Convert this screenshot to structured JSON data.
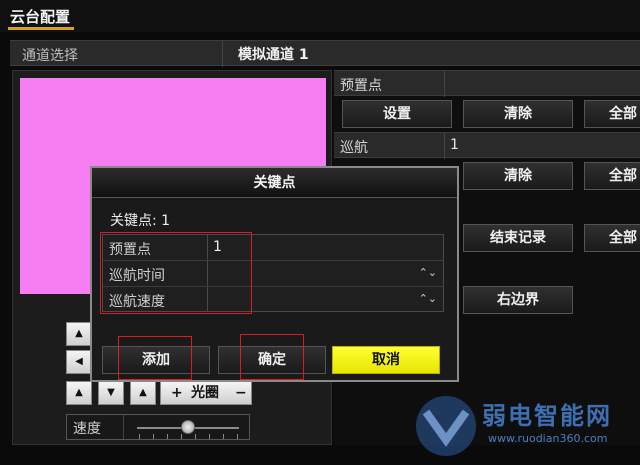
{
  "header": {
    "title": "云台配置"
  },
  "channel": {
    "label": "通道选择",
    "value": "模拟通道 1"
  },
  "preset": {
    "label": "预置点",
    "buttons": {
      "set": "设置",
      "clear": "清除",
      "all": "全部"
    }
  },
  "cruise": {
    "label": "巡航",
    "value": "1",
    "buttons": {
      "clear": "清除",
      "all": "全部"
    }
  },
  "pattern": {
    "buttons": {
      "stop_record": "结束记录",
      "all": "全部"
    }
  },
  "scan": {
    "buttons": {
      "right_border": "右边界"
    }
  },
  "ptz": {
    "iris": {
      "plus": "+",
      "label": "光圈",
      "minus": "−"
    },
    "speed_label": "速度"
  },
  "dialog": {
    "title": "关键点",
    "keypoint_label": "关键点: 1",
    "rows": [
      {
        "label": "预置点",
        "value": "1"
      },
      {
        "label": "巡航时间",
        "value": ""
      },
      {
        "label": "巡航速度",
        "value": ""
      }
    ],
    "buttons": {
      "add": "添加",
      "ok": "确定",
      "cancel": "取消"
    }
  },
  "watermark": {
    "text": "弱电智能网",
    "url": "www.ruodian360.com"
  },
  "colors": {
    "accent": "#d4a514",
    "preview": "#f77ef2",
    "cancel": "#ffff33",
    "highlight": "#d42020"
  }
}
